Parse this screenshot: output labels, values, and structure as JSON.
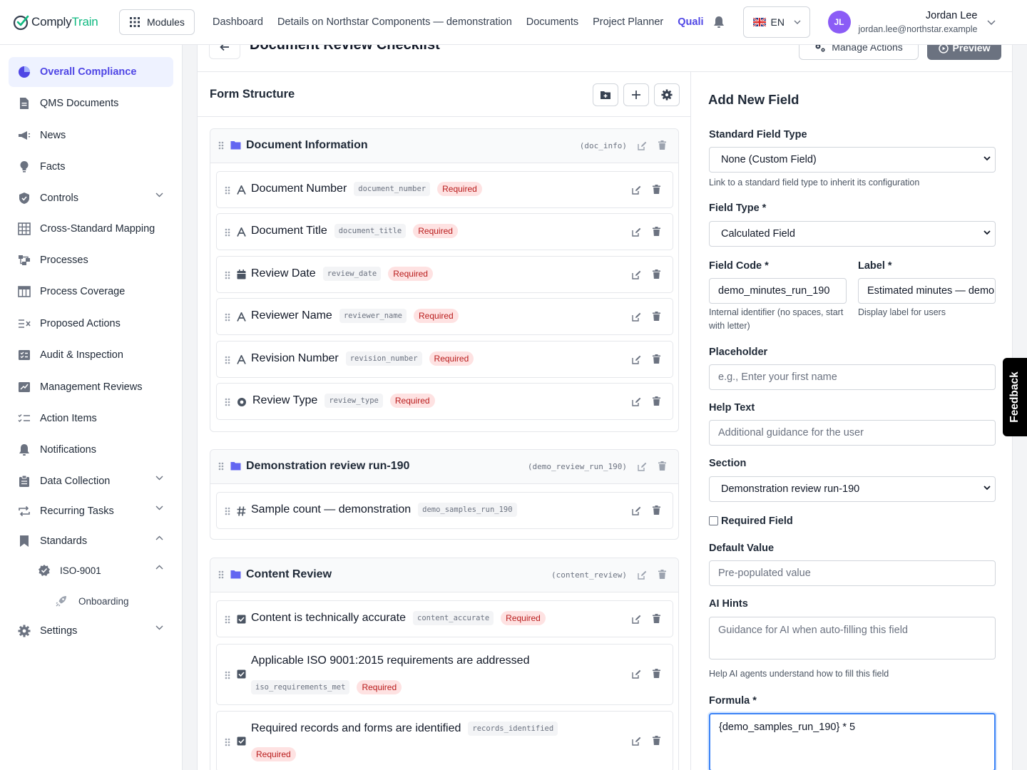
{
  "app": {
    "name_part1": "Comply",
    "name_part2": "Train"
  },
  "topbar": {
    "modules_label": "Modules",
    "nav": [
      "Dashboard",
      "Details on Northstar Components — demonstration",
      "Documents",
      "Project Planner",
      "Quali"
    ],
    "language": "EN",
    "user": {
      "initials": "JL",
      "name": "Jordan Lee",
      "email": "jordan.lee@northstar.example"
    }
  },
  "sidebar": {
    "items": [
      {
        "label": "Overall Compliance"
      },
      {
        "label": "QMS Documents"
      },
      {
        "label": "News"
      },
      {
        "label": "Facts"
      },
      {
        "label": "Controls"
      },
      {
        "label": "Cross-Standard Mapping"
      },
      {
        "label": "Processes"
      },
      {
        "label": "Process Coverage"
      },
      {
        "label": "Proposed Actions"
      },
      {
        "label": "Audit & Inspection"
      },
      {
        "label": "Management Reviews"
      },
      {
        "label": "Action Items"
      },
      {
        "label": "Notifications"
      },
      {
        "label": "Data Collection"
      },
      {
        "label": "Recurring Tasks"
      },
      {
        "label": "Standards"
      },
      {
        "label": "ISO-9001"
      },
      {
        "label": "Onboarding"
      },
      {
        "label": "Settings"
      }
    ]
  },
  "page": {
    "title": "Document Review Checklist",
    "manage_actions": "Manage Actions",
    "preview": "Preview"
  },
  "form_structure": {
    "title": "Form Structure",
    "sections": [
      {
        "title": "Document Information",
        "code": "(doc_info)",
        "fields": [
          {
            "label": "Document Number",
            "code": "document_number",
            "required": "Required"
          },
          {
            "label": "Document Title",
            "code": "document_title",
            "required": "Required"
          },
          {
            "label": "Review Date",
            "code": "review_date",
            "required": "Required"
          },
          {
            "label": "Reviewer Name",
            "code": "reviewer_name",
            "required": "Required"
          },
          {
            "label": "Revision Number",
            "code": "revision_number",
            "required": "Required"
          },
          {
            "label": "Review Type",
            "code": "review_type",
            "required": "Required"
          }
        ]
      },
      {
        "title": "Demonstration review run-190",
        "code": "(demo_review_run_190)",
        "fields": [
          {
            "label": "Sample count — demonstration",
            "code": "demo_samples_run_190"
          }
        ]
      },
      {
        "title": "Content Review",
        "code": "(content_review)",
        "fields": [
          {
            "label": "Content is technically accurate",
            "code": "content_accurate",
            "required": "Required"
          },
          {
            "label": "Applicable ISO 9001:2015 requirements are addressed",
            "code": "iso_requirements_met",
            "required": "Required"
          },
          {
            "label": "Required records and forms are identified",
            "code": "records_identified",
            "required": "Required"
          }
        ]
      }
    ]
  },
  "add_field": {
    "title": "Add New Field",
    "standard_type": {
      "label": "Standard Field Type",
      "value": "None (Custom Field)",
      "hint": "Link to a standard field type to inherit its configuration"
    },
    "field_type": {
      "label": "Field Type *",
      "value": "Calculated Field"
    },
    "field_code": {
      "label": "Field Code *",
      "value": "demo_minutes_run_190",
      "hint": "Internal identifier (no spaces, start with letter)"
    },
    "label_field": {
      "label": "Label *",
      "value": "Estimated minutes — demo",
      "hint": "Display label for users"
    },
    "placeholder": {
      "label": "Placeholder",
      "placeholder": "e.g., Enter your first name"
    },
    "help_text": {
      "label": "Help Text",
      "placeholder": "Additional guidance for the user"
    },
    "section": {
      "label": "Section",
      "value": "Demonstration review run-190"
    },
    "required": {
      "label": "Required Field"
    },
    "default_value": {
      "label": "Default Value",
      "placeholder": "Pre-populated value"
    },
    "ai_hints": {
      "label": "AI Hints",
      "placeholder": "Guidance for AI when auto-filling this field",
      "hint": "Help AI agents understand how to fill this field"
    },
    "formula": {
      "label": "Formula *",
      "value": "{demo_samples_run_190} * 5"
    }
  },
  "feedback": "Feedback",
  "colors": {
    "accent": "#4f46e5",
    "brand_green": "#10b981",
    "required_bg": "#fee2e2",
    "required_text": "#b91c1c"
  }
}
